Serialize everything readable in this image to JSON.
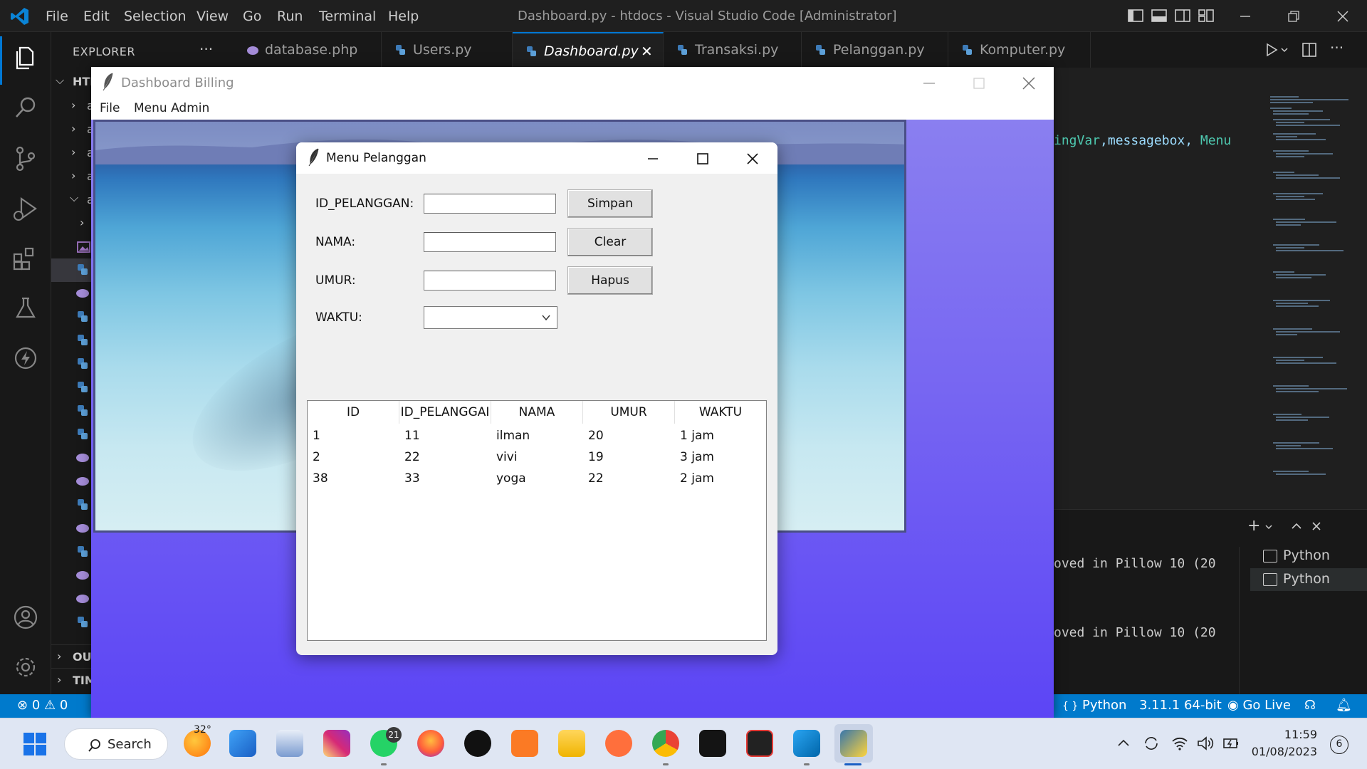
{
  "vscode": {
    "window_title": "Dashboard.py - htdocs - Visual Studio Code [Administrator]",
    "menus": [
      "File",
      "Edit",
      "Selection",
      "View",
      "Go",
      "Run",
      "Terminal",
      "Help"
    ],
    "explorer_title": "EXPLORER",
    "explorer_more": "···",
    "tree_root_label": "HTI",
    "tree_collapsed_labels": [
      "a",
      "a",
      "a",
      "a"
    ],
    "tree_expanded_label": "a",
    "outline_label": "OUT",
    "timeline_label": "TIM",
    "tabs": [
      {
        "label": "database.php",
        "icon": "php-elephant-icon"
      },
      {
        "label": "Users.py",
        "icon": "python-icon"
      },
      {
        "label": "Dashboard.py",
        "icon": "python-icon",
        "active": true
      },
      {
        "label": "Transaksi.py",
        "icon": "python-icon"
      },
      {
        "label": "Pelanggan.py",
        "icon": "python-icon"
      },
      {
        "label": "Komputer.py",
        "icon": "python-icon"
      }
    ],
    "tab_close_glyph": "✕",
    "code_fragment": {
      "a": "ingVar",
      "b": ",messagebox, ",
      "c": "Menu"
    },
    "terminal_lines": [
      "oved in Pillow 10 (20",
      "oved in Pillow 10 (20"
    ],
    "terminal_instances": [
      "Python",
      "Python"
    ],
    "statusbar": {
      "errors": "0",
      "warnings": "0",
      "language": "Python",
      "interpreter": "3.11.1 64-bit",
      "golive": "Go Live",
      "lang_braces": "{ }"
    },
    "accent": "#007acc"
  },
  "dashboard": {
    "title": "Dashboard Billing",
    "menu": [
      "File",
      "Menu Admin"
    ]
  },
  "pelanggan": {
    "title": "Menu Pelanggan",
    "fields": [
      {
        "label": "ID_PELANGGAN:",
        "value": ""
      },
      {
        "label": "NAMA:",
        "value": ""
      },
      {
        "label": "UMUR:",
        "value": ""
      }
    ],
    "waktu_label": "WAKTU:",
    "waktu_value": "",
    "buttons": [
      "Simpan",
      "Clear",
      "Hapus"
    ],
    "table": {
      "headers": [
        "ID",
        "ID_PELANGGAI",
        "NAMA",
        "UMUR",
        "WAKTU"
      ],
      "rows": [
        [
          "1",
          "11",
          "ilman",
          "20",
          "1 jam"
        ],
        [
          "2",
          "22",
          "vivi",
          "19",
          "3 jam"
        ],
        [
          "38",
          "33",
          "yoga",
          "22",
          "2 jam"
        ]
      ]
    }
  },
  "taskbar": {
    "search_label": "Search",
    "weather_temp": "32°",
    "whatsapp_badge": "21",
    "time": "11:59",
    "date": "01/08/2023",
    "notification_count": "6"
  }
}
